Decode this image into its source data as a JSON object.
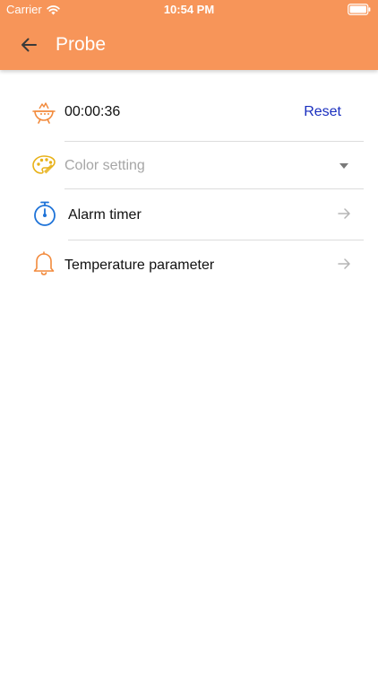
{
  "status_bar": {
    "carrier": "Carrier",
    "time": "10:54 PM"
  },
  "nav": {
    "title": "Probe",
    "back_icon": "arrow-left-icon"
  },
  "timer_row": {
    "icon": "grill-icon",
    "value": "00:00:36",
    "action_label": "Reset"
  },
  "menu": {
    "color_setting": {
      "icon": "palette-icon",
      "label": "Color setting",
      "trailing_icon": "dropdown-triangle-icon"
    },
    "alarm_timer": {
      "icon": "stopwatch-icon",
      "label": "Alarm timer",
      "trailing_icon": "arrow-right-icon"
    },
    "temperature_parameter": {
      "icon": "bell-icon",
      "label": "Temperature parameter",
      "trailing_icon": "arrow-right-icon"
    }
  },
  "colors": {
    "header": "#f79559",
    "accent_orange": "#f28a3c",
    "palette_yellow": "#e8b21a",
    "stopwatch_blue": "#1e73d8",
    "link_blue": "#1a2fbf"
  }
}
